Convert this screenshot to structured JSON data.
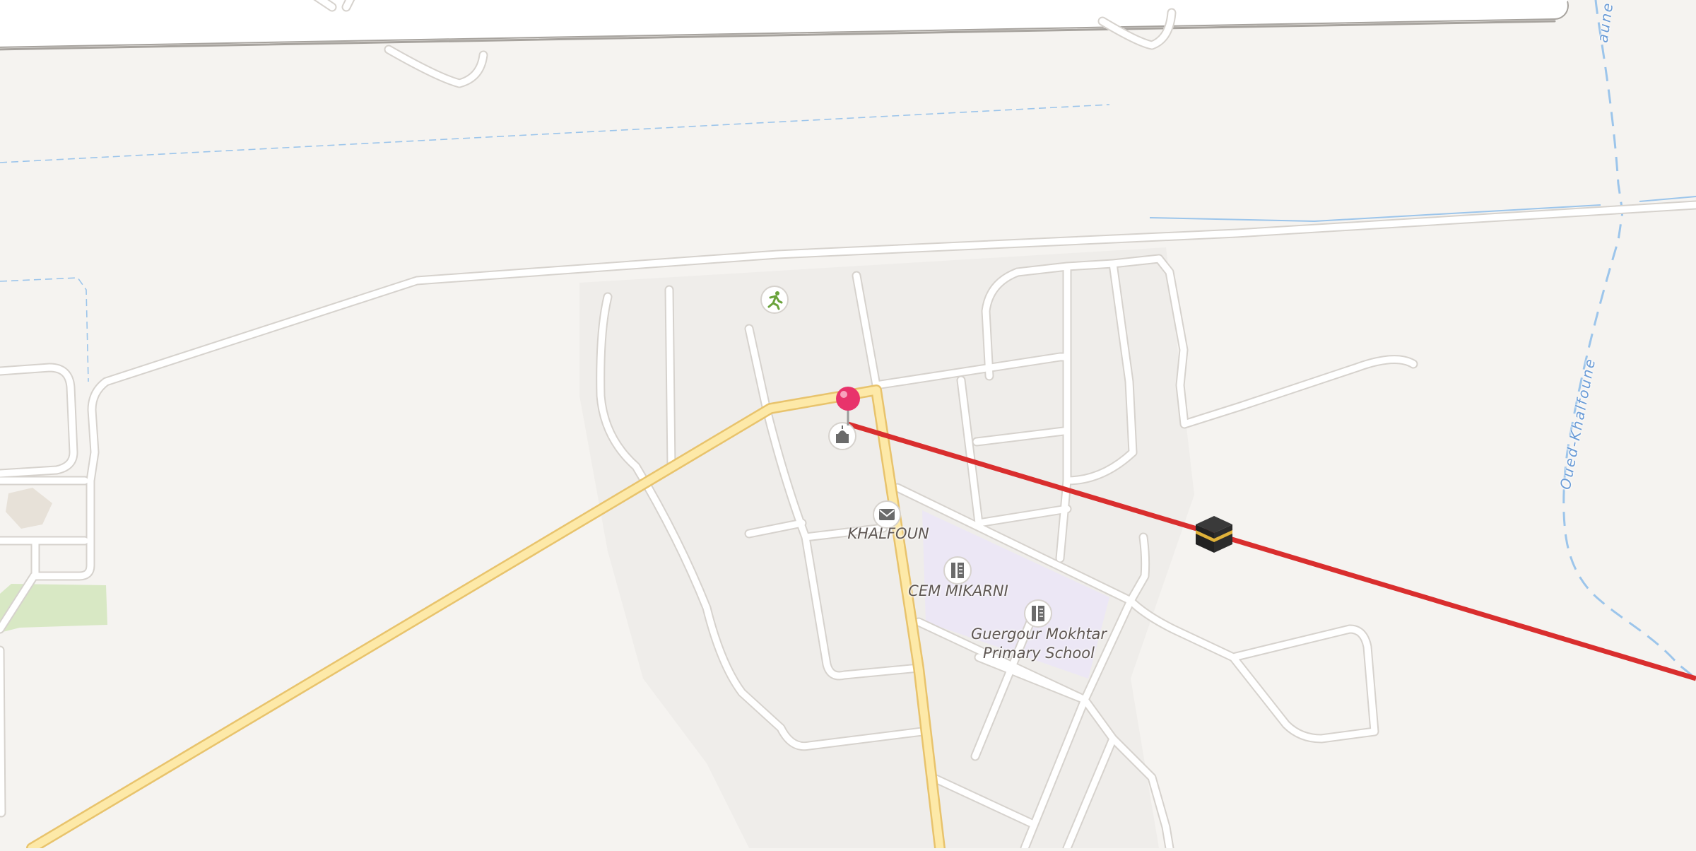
{
  "map": {
    "labels": {
      "locality": "KHALFOUN",
      "school_1": "CEM MIKARNI",
      "school_2": "Guergour Mokhtar\nPrimary School",
      "stream": "Oued-Khalfoune",
      "stream_fragment": "aune"
    },
    "pois": [
      {
        "name": "sports-pitch",
        "icon": "running-person-icon",
        "color": "#6aa33b"
      },
      {
        "name": "mosque",
        "icon": "mosque-icon",
        "color": "#6b6b6b"
      },
      {
        "name": "post-office",
        "icon": "envelope-icon",
        "color": "#6b6b6b"
      },
      {
        "name": "school",
        "icon": "school-icon",
        "color": "#6b6b6b"
      },
      {
        "name": "school",
        "icon": "school-icon",
        "color": "#6b6b6b"
      }
    ],
    "markers": {
      "location_pin": {
        "icon": "map-pin-icon",
        "color": "#e8336b"
      },
      "qibla_direction": {
        "icon": "kaaba-icon",
        "line_color": "#d92e2e"
      }
    },
    "colors": {
      "background": "#f5f3f0",
      "residential": "#efedea",
      "road": "#ffffff",
      "road_casing": "#d6d2cd",
      "primary_road": "#fde9a8",
      "primary_casing": "#e8c36c",
      "school_area": "#ece7f5",
      "grass": "#d8e8c4",
      "water": "#9cc5eb"
    }
  }
}
